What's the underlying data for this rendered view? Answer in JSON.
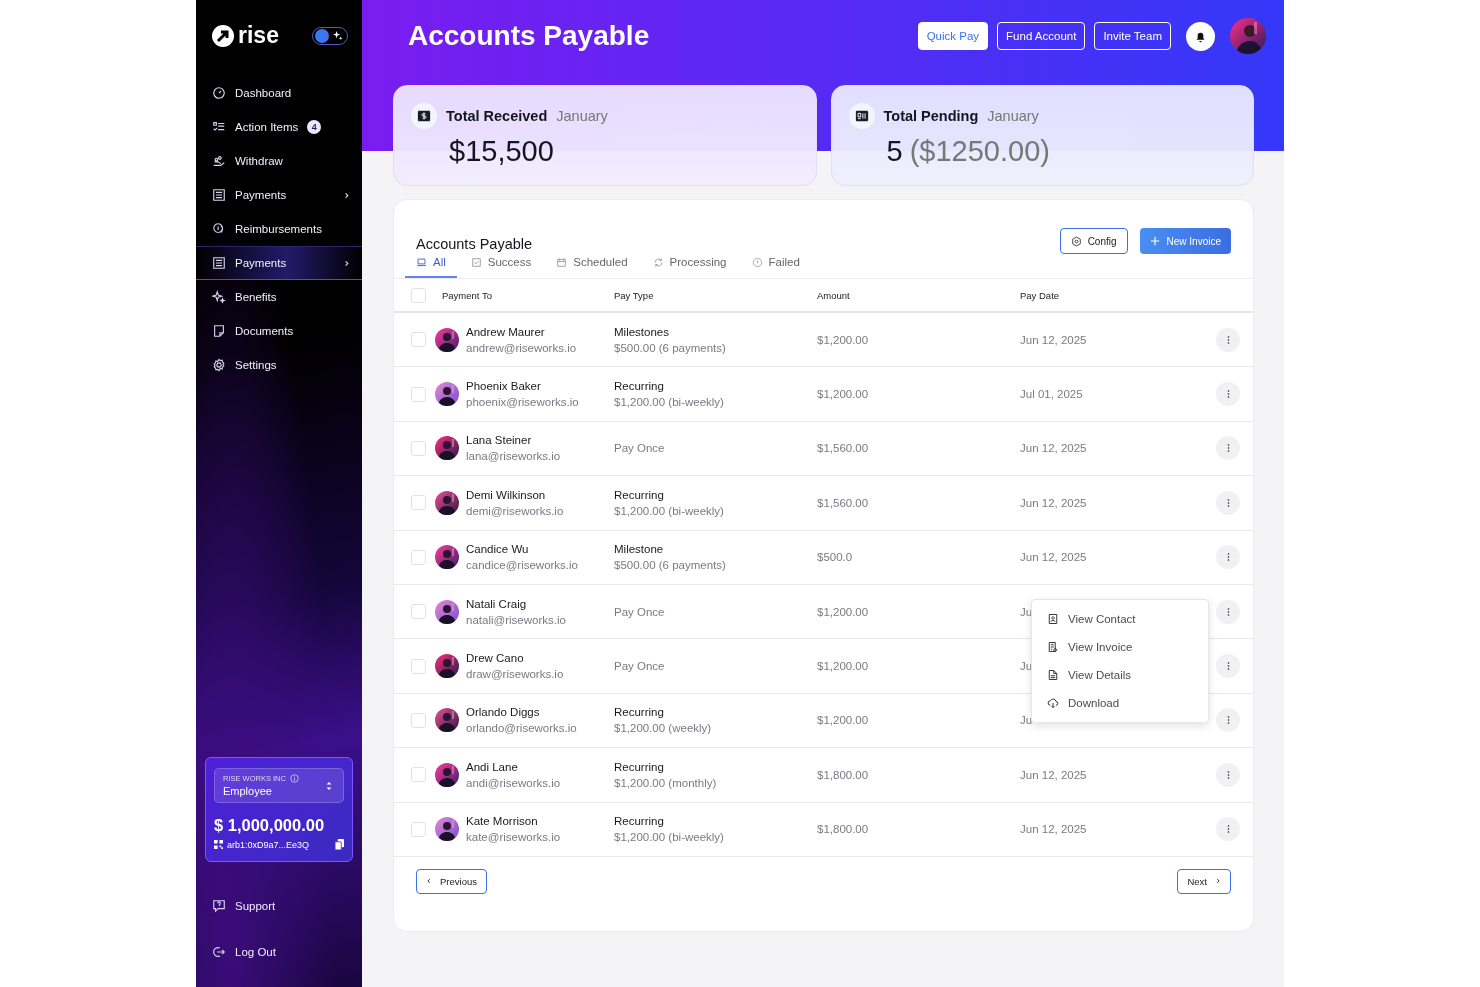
{
  "sidebar": {
    "brand": "rise",
    "theme_toggle": {
      "on": false
    },
    "items": [
      {
        "label": "Dashboard",
        "selected": false,
        "has_submenu": false
      },
      {
        "label": "Action Items",
        "badge": "4",
        "selected": false,
        "has_submenu": false
      },
      {
        "label": "Withdraw",
        "selected": false,
        "has_submenu": false
      },
      {
        "label": "Payments",
        "selected": false,
        "has_submenu": true
      },
      {
        "label": "Reimbursements",
        "selected": false,
        "has_submenu": false
      },
      {
        "label": "Payments",
        "selected": true,
        "has_submenu": true
      },
      {
        "label": "Benefits",
        "selected": false,
        "has_submenu": false
      },
      {
        "label": "Documents",
        "selected": false,
        "has_submenu": false
      },
      {
        "label": "Settings",
        "selected": false,
        "has_submenu": false
      }
    ],
    "wallet": {
      "company": "RISE WORKS INC",
      "role": "Employee",
      "balance": "$ 1,000,000.00",
      "address": "arb1:0xD9a7...Ee3Q"
    },
    "footer_items": [
      {
        "label": "Support"
      },
      {
        "label": "Log Out"
      }
    ]
  },
  "header": {
    "title": "Accounts Payable",
    "buttons": [
      {
        "label": "Quick Pay",
        "kind": "primary"
      },
      {
        "label": "Fund Account",
        "kind": "outline"
      },
      {
        "label": "Invite Team",
        "kind": "outline"
      }
    ]
  },
  "summary": [
    {
      "title": "Total Received",
      "period": "January",
      "value": "$15,500"
    },
    {
      "title": "Total Pending",
      "period": "January",
      "value": "5",
      "sub": "($1250.00)"
    }
  ],
  "table": {
    "title": "Accounts Payable",
    "config": "Config",
    "new_invoice": "New Invoice",
    "tabs": [
      {
        "label": "All",
        "selected": true
      },
      {
        "label": "Success",
        "selected": false
      },
      {
        "label": "Scheduled",
        "selected": false
      },
      {
        "label": "Processing",
        "selected": false
      },
      {
        "label": "Failed",
        "selected": false
      }
    ],
    "select_all_checked": false,
    "columns": [
      "Payment To",
      "Pay Type",
      "Amount",
      "Pay Date"
    ],
    "rows": [
      {
        "name": "Andrew Maurer",
        "email": "andrew@riseworks.io",
        "pay_type": "Milestones",
        "pay_detail": "$500.00 (6 payments)",
        "amount": "$1,200.00",
        "date": "Jun 12, 2025",
        "checked": false,
        "menu_open": false
      },
      {
        "name": "Phoenix Baker",
        "email": "phoenix@riseworks.io",
        "pay_type": "Recurring",
        "pay_detail": "$1,200.00 (bi-weekly)",
        "amount": "$1,200.00",
        "date": "Jul 01, 2025",
        "checked": false,
        "menu_open": false
      },
      {
        "name": "Lana Steiner",
        "email": "lana@riseworks.io",
        "pay_type": "Pay Once",
        "amount": "$1,560.00",
        "date": "Jun 12, 2025",
        "checked": false,
        "menu_open": false
      },
      {
        "name": "Demi Wilkinson",
        "email": "demi@riseworks.io",
        "pay_type": "Recurring",
        "pay_detail": "$1,200.00 (bi-weekly)",
        "amount": "$1,560.00",
        "date": "Jun 12, 2025",
        "checked": false,
        "menu_open": false
      },
      {
        "name": "Candice Wu",
        "email": "candice@riseworks.io",
        "pay_type": "Milestone",
        "pay_detail": "$500.00 (6 payments)",
        "amount": "$500.0",
        "date": "Jun 12, 2025",
        "checked": false,
        "menu_open": false
      },
      {
        "name": "Natali Craig",
        "email": "natali@riseworks.io",
        "pay_type": "Pay Once",
        "amount": "$1,200.00",
        "date": "Ju",
        "checked": false,
        "menu_open": true
      },
      {
        "name": "Drew Cano",
        "email": "draw@riseworks.io",
        "pay_type": "Pay Once",
        "amount": "$1,200.00",
        "date": "Ju",
        "checked": false,
        "menu_open": false
      },
      {
        "name": "Orlando Diggs",
        "email": "orlando@riseworks.io",
        "pay_type": "Recurring",
        "pay_detail": "$1,200.00 (weekly)",
        "amount": "$1,200.00",
        "date": "Ju",
        "checked": false,
        "menu_open": false
      },
      {
        "name": "Andi Lane",
        "email": "andi@riseworks.io",
        "pay_type": "Recurring",
        "pay_detail": "$1,200.00 (monthly)",
        "amount": "$1,800.00",
        "date": "Jun 12, 2025",
        "checked": false,
        "menu_open": false
      },
      {
        "name": "Kate Morrison",
        "email": "kate@riseworks.io",
        "pay_type": "Recurring",
        "pay_detail": "$1,200.00 (bi-weekly)",
        "amount": "$1,800.00",
        "date": "Jun 12, 2025",
        "checked": false,
        "menu_open": false
      }
    ],
    "row_menu": [
      "View Contact",
      "View Invoice",
      "View Details",
      "Download"
    ],
    "pagination": {
      "previous": "Previous",
      "next": "Next"
    }
  }
}
